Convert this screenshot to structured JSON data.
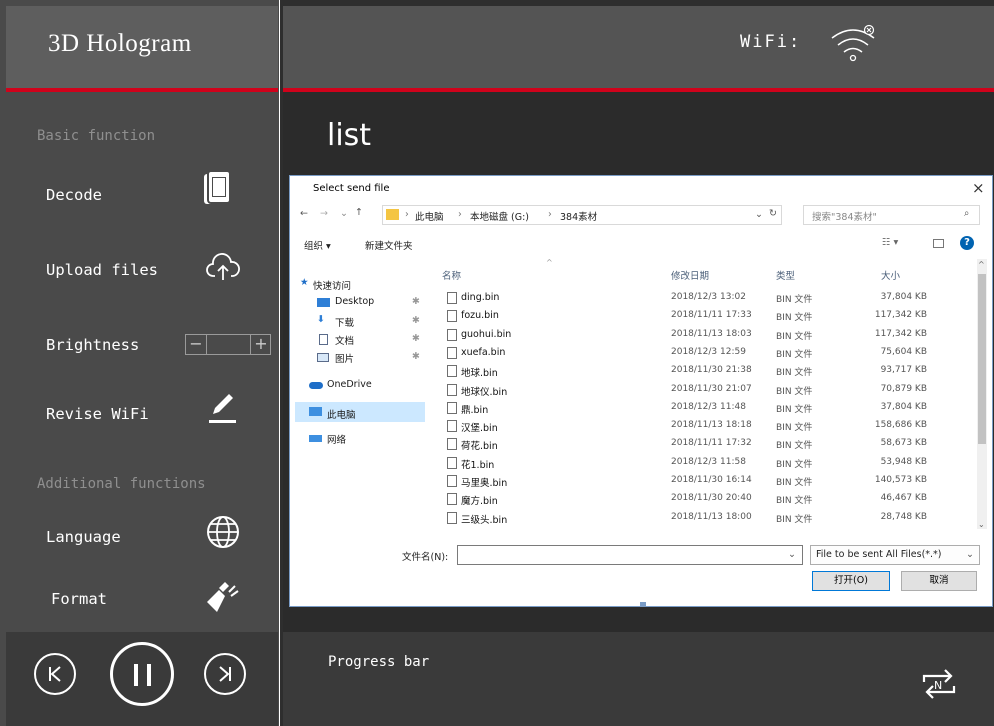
{
  "app": {
    "title": "3D  Hologram",
    "wifi_label": "WiFi:",
    "list_title": "list",
    "progress_label": "Progress bar"
  },
  "sidebar": {
    "section_basic": "Basic function",
    "section_additional": "Additional functions",
    "items": [
      {
        "label": "Decode",
        "icon": "document-icon"
      },
      {
        "label": "Upload files",
        "icon": "cloud-upload-icon"
      },
      {
        "label": "Brightness",
        "icon": "brightness-stepper"
      },
      {
        "label": "Revise WiFi",
        "icon": "pencil-icon"
      },
      {
        "label": "Language",
        "icon": "globe-icon"
      },
      {
        "label": "Format",
        "icon": "broom-icon"
      }
    ],
    "brightness_minus": "−",
    "brightness_plus": "+"
  },
  "dialog": {
    "title": "Select send file",
    "close": "×",
    "breadcrumb": [
      "此电脑",
      "本地磁盘 (G:)",
      "384素材"
    ],
    "search_placeholder": "搜索\"384素材\"",
    "toolbar": {
      "organize": "组织 ▾",
      "new_folder": "新建文件夹"
    },
    "nav": [
      {
        "label": "快速访问",
        "icon": "star-icon"
      },
      {
        "label": "Desktop",
        "icon": "desktop-icon"
      },
      {
        "label": "下载",
        "icon": "download-icon"
      },
      {
        "label": "文档",
        "icon": "docs-icon"
      },
      {
        "label": "图片",
        "icon": "pictures-icon"
      },
      {
        "label": "OneDrive",
        "icon": "cloud-icon"
      },
      {
        "label": "此电脑",
        "icon": "computer-icon"
      },
      {
        "label": "网络",
        "icon": "network-icon"
      }
    ],
    "columns": {
      "name": "名称",
      "date": "修改日期",
      "type": "类型",
      "size": "大小"
    },
    "files": [
      {
        "name": "ding.bin",
        "date": "2018/12/3 13:02",
        "type": "BIN 文件",
        "size": "37,804 KB"
      },
      {
        "name": "fozu.bin",
        "date": "2018/11/11 17:33",
        "type": "BIN 文件",
        "size": "117,342 KB"
      },
      {
        "name": "guohui.bin",
        "date": "2018/11/13 18:03",
        "type": "BIN 文件",
        "size": "117,342 KB"
      },
      {
        "name": "xuefa.bin",
        "date": "2018/12/3 12:59",
        "type": "BIN 文件",
        "size": "75,604 KB"
      },
      {
        "name": "地球.bin",
        "date": "2018/11/30 21:38",
        "type": "BIN 文件",
        "size": "93,717 KB"
      },
      {
        "name": "地球仪.bin",
        "date": "2018/11/30 21:07",
        "type": "BIN 文件",
        "size": "70,879 KB"
      },
      {
        "name": "鼎.bin",
        "date": "2018/12/3 11:48",
        "type": "BIN 文件",
        "size": "37,804 KB"
      },
      {
        "name": "汉堡.bin",
        "date": "2018/11/13 18:18",
        "type": "BIN 文件",
        "size": "158,686 KB"
      },
      {
        "name": "荷花.bin",
        "date": "2018/11/11 17:32",
        "type": "BIN 文件",
        "size": "58,673 KB"
      },
      {
        "name": "花1.bin",
        "date": "2018/12/3 11:58",
        "type": "BIN 文件",
        "size": "53,948 KB"
      },
      {
        "name": "马里奥.bin",
        "date": "2018/11/30 16:14",
        "type": "BIN 文件",
        "size": "140,573 KB"
      },
      {
        "name": "魔方.bin",
        "date": "2018/11/30 20:40",
        "type": "BIN 文件",
        "size": "46,467 KB"
      },
      {
        "name": "三级头.bin",
        "date": "2018/11/13 18:00",
        "type": "BIN 文件",
        "size": "28,748 KB"
      }
    ],
    "filename_label": "文件名(N):",
    "filename_value": "",
    "filetype_value": "File to be sent All Files(*.*)",
    "open_label": "打开(O)",
    "cancel_label": "取消"
  },
  "colors": {
    "accent_red": "#d0021b",
    "sidebar_bg": "#4a4a4a",
    "main_bg": "#2e2e2e"
  }
}
